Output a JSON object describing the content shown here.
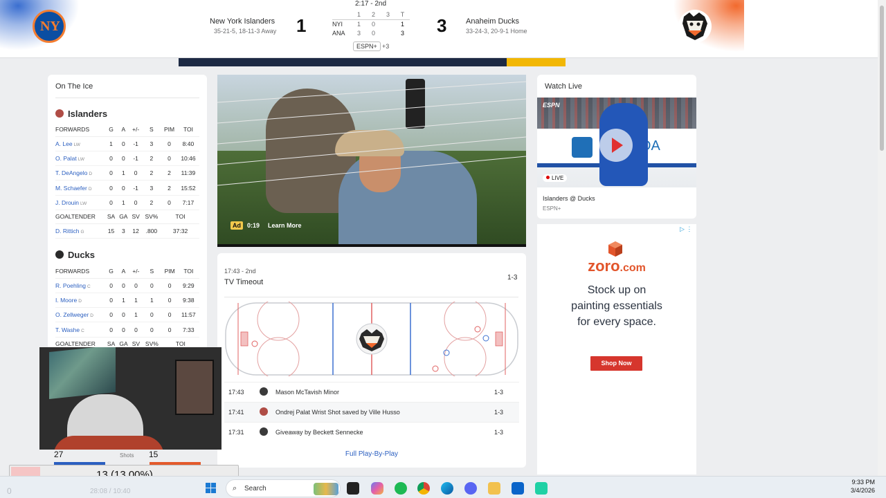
{
  "header": {
    "clock": "2:17 - 2nd",
    "home_team_away": {
      "name": "New York Islanders",
      "record": "35-21-5, 18-11-3 Away",
      "score": "1",
      "logo": "NY"
    },
    "away_team_home": {
      "name": "Anaheim Ducks",
      "record": "33-24-3, 20-9-1 Home",
      "score": "3"
    },
    "linescore": {
      "headers": [
        "1",
        "2",
        "3",
        "T"
      ],
      "rows": [
        {
          "team": "NYI",
          "p1": "1",
          "p2": "0",
          "p3": "",
          "t": "1"
        },
        {
          "team": "ANA",
          "p1": "3",
          "p2": "0",
          "p3": "",
          "t": "3"
        }
      ]
    },
    "network": "ESPN+",
    "network_more": "+3",
    "colors": {
      "islanders_blue": "#0b4ea2",
      "islanders_orange": "#f47d30",
      "ducks_orange": "#f26a2e"
    }
  },
  "on_ice": {
    "title": "On The Ice",
    "islanders": {
      "name": "Islanders",
      "skater_headers": [
        "FORWARDS",
        "G",
        "A",
        "+/-",
        "S",
        "PIM",
        "TOI"
      ],
      "skaters": [
        {
          "name": "A. Lee",
          "pos": "LW",
          "g": "1",
          "a": "0",
          "pm": "-1",
          "s": "3",
          "pim": "0",
          "toi": "8:40"
        },
        {
          "name": "O. Palat",
          "pos": "LW",
          "g": "0",
          "a": "0",
          "pm": "-1",
          "s": "2",
          "pim": "0",
          "toi": "10:46"
        },
        {
          "name": "T. DeAngelo",
          "pos": "D",
          "g": "0",
          "a": "1",
          "pm": "0",
          "s": "2",
          "pim": "2",
          "toi": "11:39"
        },
        {
          "name": "M. Schaefer",
          "pos": "D",
          "g": "0",
          "a": "0",
          "pm": "-1",
          "s": "3",
          "pim": "2",
          "toi": "15:52"
        },
        {
          "name": "J. Drouin",
          "pos": "LW",
          "g": "0",
          "a": "1",
          "pm": "0",
          "s": "2",
          "pim": "0",
          "toi": "7:17"
        }
      ],
      "goalie_headers": [
        "GOALTENDER",
        "SA",
        "GA",
        "SV",
        "SV%",
        "TOI"
      ],
      "goalie": {
        "name": "D. Rittich",
        "pos": "G",
        "sa": "15",
        "ga": "3",
        "sv": "12",
        "svp": ".800",
        "toi": "37:32"
      }
    },
    "ducks": {
      "name": "Ducks",
      "skater_headers": [
        "FORWARDS",
        "G",
        "A",
        "+/-",
        "S",
        "PIM",
        "TOI"
      ],
      "skaters": [
        {
          "name": "R. Poehling",
          "pos": "C",
          "g": "0",
          "a": "0",
          "pm": "0",
          "s": "0",
          "pim": "0",
          "toi": "9:29"
        },
        {
          "name": "I. Moore",
          "pos": "D",
          "g": "0",
          "a": "1",
          "pm": "1",
          "s": "1",
          "pim": "0",
          "toi": "9:38"
        },
        {
          "name": "O. Zellweger",
          "pos": "D",
          "g": "0",
          "a": "0",
          "pm": "1",
          "s": "0",
          "pim": "0",
          "toi": "11:57"
        },
        {
          "name": "T. Washe",
          "pos": "C",
          "g": "0",
          "a": "0",
          "pm": "0",
          "s": "0",
          "pim": "0",
          "toi": "7:33"
        }
      ],
      "goalie_headers": [
        "GOALTENDER",
        "SA",
        "GA",
        "SV",
        "SV%",
        "TOI"
      ]
    }
  },
  "video": {
    "ad_label": "Ad",
    "ad_time": "0:19",
    "learn_more": "Learn More"
  },
  "play": {
    "time": "17:43 - 2nd",
    "desc": "TV Timeout",
    "score": "1-3",
    "rows": [
      {
        "time": "17:43",
        "team": "ducks",
        "desc": "Mason McTavish Minor",
        "score": "1-3"
      },
      {
        "time": "17:41",
        "team": "islanders",
        "desc": "Ondrej Palat Wrist Shot saved by Ville Husso",
        "score": "1-3"
      },
      {
        "time": "17:31",
        "team": "ducks",
        "desc": "Giveaway by Beckett Sennecke",
        "score": "1-3"
      }
    ],
    "full_link": "Full Play-By-Play"
  },
  "watch_live": {
    "title": "Watch Live",
    "brand": "ESPN",
    "live": "LIVE",
    "board_text": "DA",
    "matchup": "Islanders @ Ducks",
    "network": "ESPN+"
  },
  "ad": {
    "brand": "zoro",
    "brand_suffix": ".com",
    "text_lines": [
      "Stock up on",
      "painting essentials",
      "for every space."
    ],
    "cta": "Shop Now",
    "choices": "▷ ⋮"
  },
  "overlay": {
    "left_num": "27",
    "mid_label": "Shots",
    "right_num": "15",
    "progress_text": "13 (13.00%)",
    "progress_value": 0.13
  },
  "taskbar": {
    "search": "Search",
    "time": "9:33 PM",
    "date": "3/4/2026",
    "faint_left": "0",
    "faint_text": "28:08 / 10:40"
  }
}
